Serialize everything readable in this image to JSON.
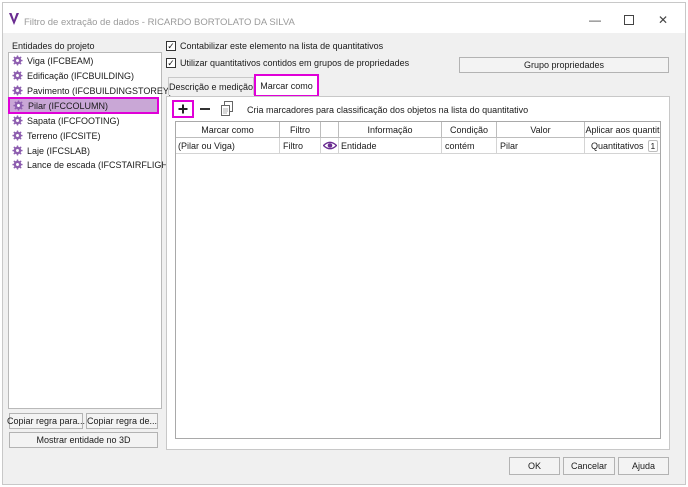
{
  "window": {
    "title": "Filtro de extração de dados - RICARDO BORTOLATO DA SILVA"
  },
  "sidebar": {
    "title": "Entidades do projeto",
    "items": [
      {
        "label": "Viga (IFCBEAM)"
      },
      {
        "label": "Edificação (IFCBUILDING)"
      },
      {
        "label": "Pavimento (IFCBUILDINGSTOREY)"
      },
      {
        "label": "Pilar (IFCCOLUMN)",
        "selected": true
      },
      {
        "label": "Sapata (IFCFOOTING)"
      },
      {
        "label": "Terreno (IFCSITE)"
      },
      {
        "label": "Laje (IFCSLAB)"
      },
      {
        "label": "Lance de escada (IFCSTAIRFLIGHT)"
      }
    ],
    "copy_rule_to_label": "Copiar regra para...",
    "copy_rule_from_label": "Copiar regra de...",
    "show_3d_label": "Mostrar entidade no 3D"
  },
  "options": {
    "count_element_label": "Contabilizar este elemento na lista de quantitativos",
    "count_element_checked": true,
    "use_groups_label": "Utilizar quantitativos contidos em grupos de propriedades",
    "use_groups_checked": true,
    "group_props_label": "Grupo propriedades"
  },
  "tabs": [
    {
      "label": "Descrição e medição",
      "active": false
    },
    {
      "label": "Marcar como",
      "active": true
    }
  ],
  "toolbar": {
    "add_icon": "plus-icon",
    "remove_icon": "minus-icon",
    "copy_icon": "copy-icon",
    "hint": "Cria marcadores para classificação dos objetos na lista do quantitativo"
  },
  "table": {
    "headers": [
      "Marcar como",
      "Filtro",
      "",
      "Informação",
      "Condição",
      "Valor",
      "Aplicar aos quantit"
    ],
    "rows": [
      {
        "marcar": "(Pilar ou Viga)",
        "filtro": "Filtro",
        "icon": "eye-icon",
        "informacao": "Entidade",
        "condicao": "contém",
        "valor": "Pilar",
        "aplicar": "Quantitativos",
        "aplicar_count": "1"
      }
    ]
  },
  "footer": {
    "ok_label": "OK",
    "cancel_label": "Cancelar",
    "help_label": "Ajuda"
  },
  "colors": {
    "highlight": "#e000d8",
    "selection": "#c9a7d6",
    "accent": "#6a2c91"
  }
}
